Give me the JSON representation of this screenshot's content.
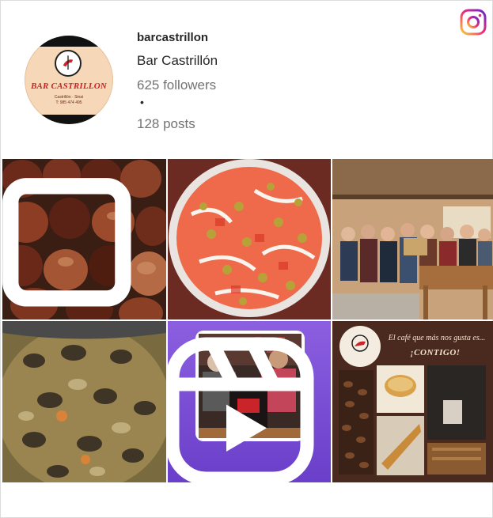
{
  "profile": {
    "username": "barcastrillon",
    "full_name": "Bar Castrillón",
    "followers": "625 followers",
    "separator": "•",
    "posts": "128 posts"
  },
  "avatar": {
    "brand": "BAR CASTRILLON",
    "line1": "Castrillón · Sinai",
    "line2": "T: 985 474 495"
  },
  "icons": {
    "instagram": "instagram-icon",
    "multi_post": "carousel-icon",
    "reel": "reel-icon"
  },
  "posts_grid": [
    {
      "subject": "roasted chestnuts",
      "type": "carousel"
    },
    {
      "subject": "tomato salad with olives",
      "type": "photo"
    },
    {
      "subject": "group photo in bar",
      "type": "photo"
    },
    {
      "subject": "clam stew",
      "type": "photo"
    },
    {
      "subject": "couple in bar with sign",
      "type": "reel"
    },
    {
      "subject": "coffee promotion",
      "type": "photo",
      "text_1": "El café que más nos gusta es...",
      "text_2": "¡CONTIGO!"
    }
  ],
  "colors": {
    "instagram_gradient": [
      "#f9ce34",
      "#ee2a7b",
      "#6228d7"
    ],
    "reel_bg": "#7c4fd6",
    "promo_bg": "#4a2a1e"
  }
}
